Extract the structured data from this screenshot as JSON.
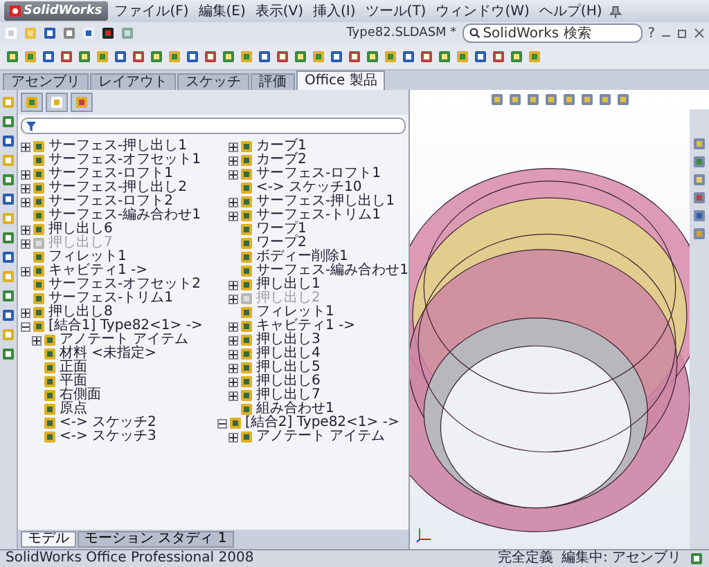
{
  "app": {
    "logo": "SolidWorks",
    "menu": [
      {
        "label": "ファイル(F)"
      },
      {
        "label": "編集(E)"
      },
      {
        "label": "表示(V)"
      },
      {
        "label": "挿入(I)"
      },
      {
        "label": "ツール(T)"
      },
      {
        "label": "ウィンドウ(W)"
      },
      {
        "label": "ヘルプ(H)"
      }
    ],
    "document_title": "Type82.SLDASM *",
    "search": {
      "placeholder": "SolidWorks 検索"
    },
    "help": "?"
  },
  "command_tabs": [
    {
      "label": "アセンブリ",
      "selected": false
    },
    {
      "label": "レイアウト",
      "selected": false
    },
    {
      "label": "スケッチ",
      "selected": false
    },
    {
      "label": "評価",
      "selected": false
    },
    {
      "label": "Office 製品",
      "selected": true
    }
  ],
  "feature_tree": {
    "items": [
      {
        "label": "サーフェス-押し出し1",
        "suppressed": false,
        "expanded": false
      },
      {
        "label": "サーフェス-オフセット1",
        "suppressed": false
      },
      {
        "label": "サーフェス-ロフト1",
        "suppressed": false,
        "expanded": false
      },
      {
        "label": "サーフェス-押し出し2",
        "suppressed": false,
        "expanded": false
      },
      {
        "label": "サーフェス-ロフト2",
        "suppressed": false,
        "expanded": false
      },
      {
        "label": "サーフェス-編み合わせ1",
        "suppressed": false
      },
      {
        "label": "押し出し6",
        "suppressed": false,
        "expanded": false
      },
      {
        "label": "押し出し7",
        "suppressed": true,
        "expanded": false
      },
      {
        "label": "フィレット1",
        "suppressed": false
      },
      {
        "label": "キャビティ1 ->",
        "suppressed": false,
        "expanded": false
      },
      {
        "label": "サーフェス-オフセット2",
        "suppressed": false
      },
      {
        "label": "サーフェス-トリム1",
        "suppressed": false
      },
      {
        "label": "押し出し8",
        "suppressed": false,
        "expanded": false
      },
      {
        "label": "[結合1] Type82<1> ->",
        "suppressed": false,
        "expanded": true,
        "children": [
          {
            "label": "アノテート アイテム",
            "suppressed": false,
            "expanded": false
          },
          {
            "label": "材料 <未指定>",
            "suppressed": false
          },
          {
            "label": "正面",
            "suppressed": false
          },
          {
            "label": "平面",
            "suppressed": false
          },
          {
            "label": "右側面",
            "suppressed": false
          },
          {
            "label": "原点",
            "suppressed": false
          },
          {
            "label": "<-> スケッチ2",
            "suppressed": false
          },
          {
            "label": "<-> スケッチ3",
            "suppressed": false
          },
          {
            "label": "カーブ1",
            "suppressed": false,
            "expanded": false
          },
          {
            "label": "カーブ2",
            "suppressed": false,
            "expanded": false
          },
          {
            "label": "サーフェス-ロフト1",
            "suppressed": false,
            "expanded": false
          },
          {
            "label": "<-> スケッチ10",
            "suppressed": false
          },
          {
            "label": "サーフェス-押し出し1",
            "suppressed": false,
            "expanded": false
          },
          {
            "label": "サーフェス-トリム1",
            "suppressed": false,
            "expanded": false
          },
          {
            "label": "ワープ1",
            "suppressed": false
          },
          {
            "label": "ワープ2",
            "suppressed": false
          },
          {
            "label": "ボディー削除1",
            "suppressed": false
          },
          {
            "label": "サーフェス-編み合わせ1",
            "suppressed": false
          },
          {
            "label": "押し出し1",
            "suppressed": false,
            "expanded": false
          },
          {
            "label": "押し出し2",
            "suppressed": true,
            "expanded": false
          },
          {
            "label": "フィレット1",
            "suppressed": false
          },
          {
            "label": "キャビティ1 ->",
            "suppressed": false,
            "expanded": false
          },
          {
            "label": "押し出し3",
            "suppressed": false,
            "expanded": false
          },
          {
            "label": "押し出し4",
            "suppressed": false,
            "expanded": false
          },
          {
            "label": "押し出し5",
            "suppressed": false,
            "expanded": false
          },
          {
            "label": "押し出し6",
            "suppressed": false,
            "expanded": false
          },
          {
            "label": "押し出し7",
            "suppressed": false,
            "expanded": false
          },
          {
            "label": "組み合わせ1",
            "suppressed": false
          }
        ]
      },
      {
        "label": "[結合2] Type82<1> ->",
        "suppressed": false,
        "expanded": true,
        "children": [
          {
            "label": "アノテート アイテム",
            "suppressed": false,
            "expanded": false
          }
        ]
      }
    ]
  },
  "bottom_tabs": [
    {
      "label": "モデル",
      "selected": true
    },
    {
      "label": "モーション スタディ 1",
      "selected": false
    }
  ],
  "status_bar": {
    "product": "SolidWorks Office Professional 2008",
    "state": "完全定義",
    "mode": "編集中: アセンブリ"
  }
}
